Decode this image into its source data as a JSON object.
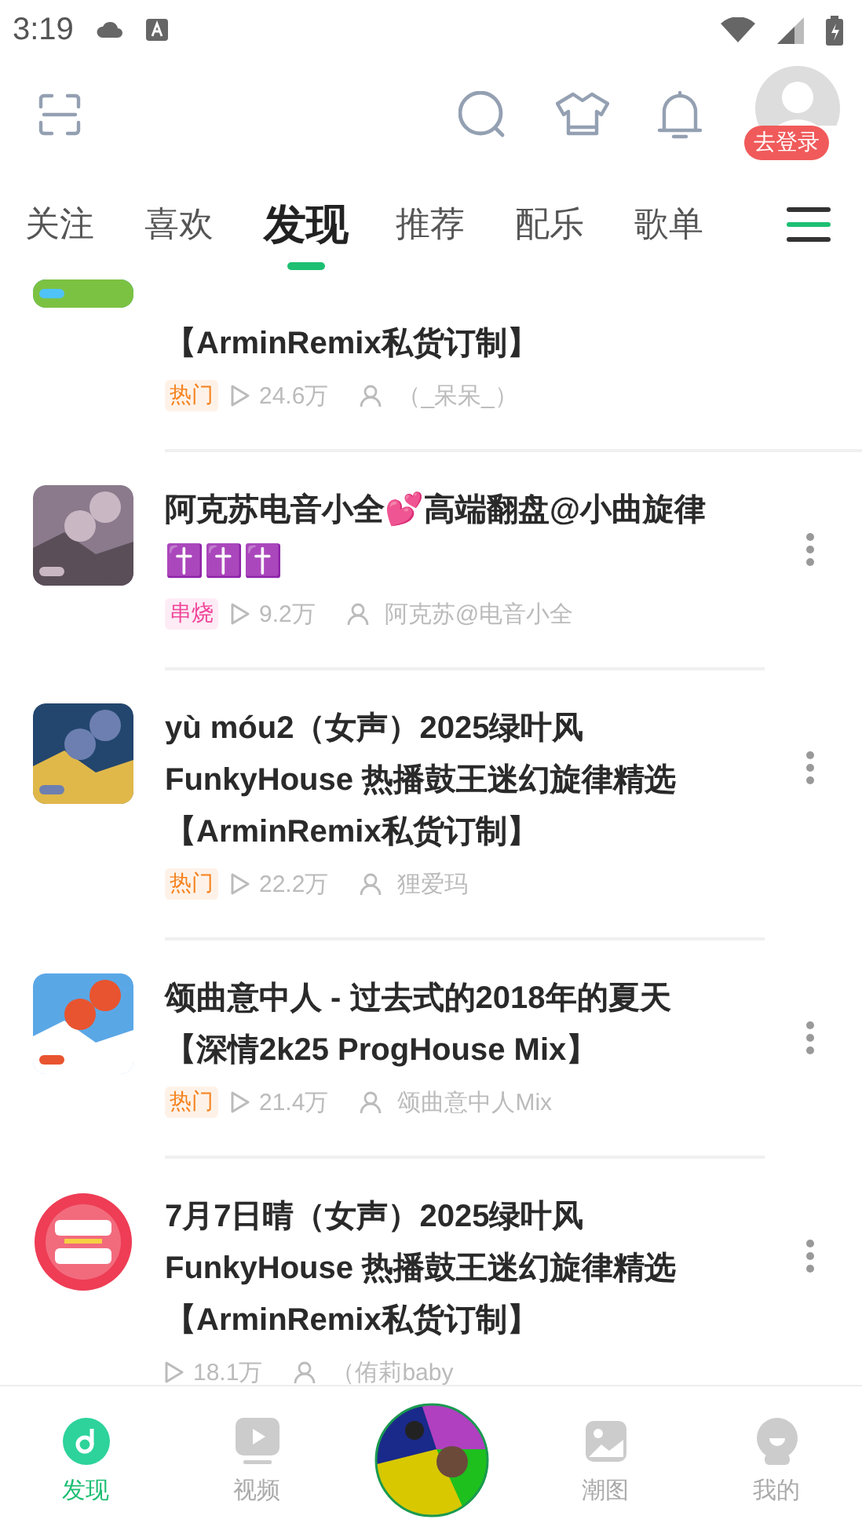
{
  "status_bar": {
    "time": "3:19"
  },
  "header": {
    "login_badge": "去登录"
  },
  "tabs": [
    {
      "label": "关注",
      "selected": false
    },
    {
      "label": "喜欢",
      "selected": false
    },
    {
      "label": "发现",
      "selected": true
    },
    {
      "label": "推荐",
      "selected": false
    },
    {
      "label": "配乐",
      "selected": false
    },
    {
      "label": "歌单",
      "selected": false
    }
  ],
  "items": [
    {
      "cut_off": true,
      "title": "【ArminRemix私货订制】",
      "tag": {
        "text": "热门",
        "color": "#f5821f"
      },
      "plays": "24.6万",
      "author": "（_呆呆_）"
    },
    {
      "cut_off": false,
      "title": "阿克苏电音小全💕高端翻盘@小曲旋律✝️✝️✝️",
      "tag": {
        "text": "串烧",
        "color": "#f0459a"
      },
      "plays": "9.2万",
      "author": "阿克苏@电音小全"
    },
    {
      "cut_off": false,
      "title": "yù móu2（女声）2025绿叶风 FunkyHouse 热播鼓王迷幻旋律精选【ArminRemix私货订制】",
      "tag": {
        "text": "热门",
        "color": "#f5821f"
      },
      "plays": "22.2万",
      "author": "狸爱玛"
    },
    {
      "cut_off": false,
      "title": "颂曲意中人 - 过去式的2018年的夏天【深情2k25 ProgHouse Mix】",
      "tag": {
        "text": "热门",
        "color": "#f5821f"
      },
      "plays": "21.4万",
      "author": "颂曲意中人Mix"
    },
    {
      "cut_off": false,
      "title": "7月7日晴（女声）2025绿叶风 FunkyHouse 热播鼓王迷幻旋律精选【ArminRemix私货订制】",
      "plays": "18.1万",
      "author": "（侑莉baby"
    }
  ],
  "bottom_nav": [
    {
      "kind": "tab",
      "label": "发现",
      "selected": true
    },
    {
      "kind": "tab",
      "label": "视频",
      "selected": false
    },
    {
      "kind": "disc"
    },
    {
      "kind": "tab",
      "label": "潮图",
      "selected": false
    },
    {
      "kind": "tab",
      "label": "我的",
      "selected": false
    }
  ]
}
